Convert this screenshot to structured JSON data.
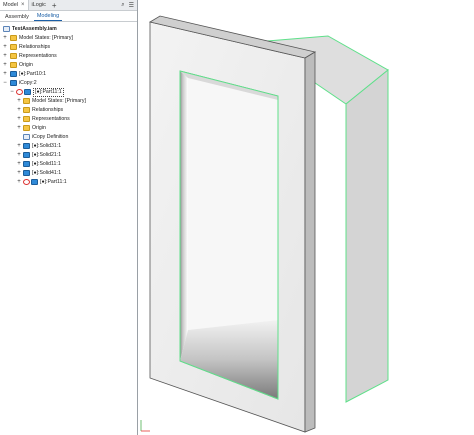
{
  "browser": {
    "tabs": [
      {
        "label": "Model",
        "close": "×"
      },
      {
        "label": "iLogic"
      }
    ],
    "add_tab": "+",
    "subtabs": [
      "Assembly",
      "Modeling"
    ],
    "tree": [
      {
        "label": "TestAssembly.iam",
        "bold": true
      },
      {
        "label": "Model States: [Primary]"
      },
      {
        "label": "Relationships"
      },
      {
        "label": "Representations"
      },
      {
        "label": "Origin"
      },
      {
        "label": "[●]:Part10:1"
      },
      {
        "label": "iCopy:2"
      },
      {
        "label": "[●]:Part11:1"
      },
      {
        "label": "Model States: [Primary]"
      },
      {
        "label": "Relationships"
      },
      {
        "label": "Representations"
      },
      {
        "label": "Origin"
      },
      {
        "label": "iCopy Definition"
      },
      {
        "label": "[●]:Solid31:1"
      },
      {
        "label": "[●]:Solid21:1"
      },
      {
        "label": "[●]:Solid11:1"
      },
      {
        "label": "[●]:Solid41:1"
      },
      {
        "label": "[●]:Part11:1"
      }
    ]
  },
  "viewport": {
    "edge_highlight_color": "#5fe08a",
    "face_light": "#ededed",
    "face_mid": "#d9d9d9",
    "face_dark": "#bdbdbd"
  }
}
